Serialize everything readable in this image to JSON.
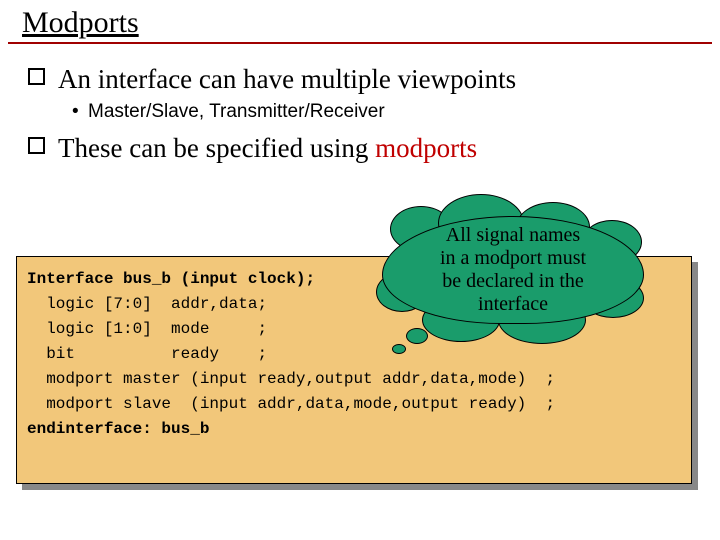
{
  "title": "Modports",
  "bullets": {
    "b1a": "An interface can have multiple viewpoints",
    "b2a": "Master/Slave, Transmitter/Receiver",
    "b1b_pre": "These can be specified using ",
    "b1b_kw": "modports"
  },
  "cloud": {
    "l1": "All signal names",
    "l2": "in a modport must",
    "l3": "be declared in the",
    "l4": "interface"
  },
  "code": {
    "l1": "Interface bus_b (input clock);",
    "l2": "  logic [7:0]  addr,data;",
    "l3": "  logic [1:0]  mode     ;",
    "l4": "  bit          ready    ;",
    "l5": "  modport master (input ready,output addr,data,mode)  ;",
    "l6": "  modport slave  (input addr,data,mode,output ready)  ;",
    "l7": "endinterface: bus_b"
  },
  "chart_data": null
}
